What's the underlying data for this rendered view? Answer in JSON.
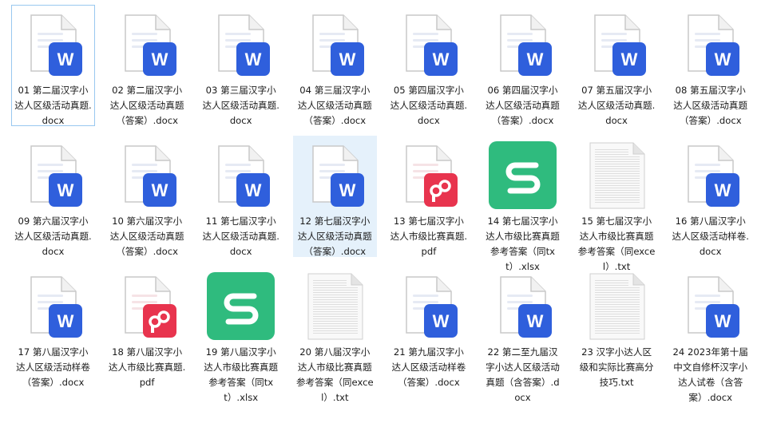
{
  "files": [
    {
      "name": "01 第二届汉字小达人区级活动真题.docx",
      "type": "docx",
      "state": "focused"
    },
    {
      "name": "02 第二届汉字小达人区级活动真题（答案）.docx",
      "type": "docx",
      "state": ""
    },
    {
      "name": "03 第三届汉字小达人区级活动真题.docx",
      "type": "docx",
      "state": ""
    },
    {
      "name": "04 第三届汉字小达人区级活动真题（答案）.docx",
      "type": "docx",
      "state": ""
    },
    {
      "name": "05 第四届汉字小达人区级活动真题.docx",
      "type": "docx",
      "state": ""
    },
    {
      "name": "06 第四届汉字小达人区级活动真题（答案）.docx",
      "type": "docx",
      "state": ""
    },
    {
      "name": "07 第五届汉字小达人区级活动真题.docx",
      "type": "docx",
      "state": ""
    },
    {
      "name": "08 第五届汉字小达人区级活动真题（答案）.docx",
      "type": "docx",
      "state": ""
    },
    {
      "name": "09 第六届汉字小达人区级活动真题.docx",
      "type": "docx",
      "state": ""
    },
    {
      "name": "10 第六届汉字小达人区级活动真题（答案）.docx",
      "type": "docx",
      "state": ""
    },
    {
      "name": "11 第七届汉字小达人区级活动真题.docx",
      "type": "docx",
      "state": ""
    },
    {
      "name": "12 第七届汉字小达人区级活动真题（答案）.docx",
      "type": "docx",
      "state": "selected"
    },
    {
      "name": "13 第七届汉字小达人市级比赛真题.pdf",
      "type": "pdf",
      "state": ""
    },
    {
      "name": "14 第七届汉字小达人市级比赛真题参考答案（同txt）.xlsx",
      "type": "xlsx",
      "state": ""
    },
    {
      "name": "15 第七届汉字小达人市级比赛真题参考答案（同excel）.txt",
      "type": "txt",
      "state": ""
    },
    {
      "name": "16 第八届汉字小达人区级活动样卷.docx",
      "type": "docx",
      "state": ""
    },
    {
      "name": "17 第八届汉字小达人区级活动样卷（答案）.docx",
      "type": "docx",
      "state": ""
    },
    {
      "name": "18 第八届汉字小达人市级比赛真题.pdf",
      "type": "pdf",
      "state": ""
    },
    {
      "name": "19 第八届汉字小达人市级比赛真题参考答案（同txt）.xlsx",
      "type": "xlsx",
      "state": ""
    },
    {
      "name": "20 第八届汉字小达人市级比赛真题参考答案（同excel）.txt",
      "type": "txt",
      "state": ""
    },
    {
      "name": "21 第九届汉字小达人区级活动样卷（答案）.docx",
      "type": "docx",
      "state": ""
    },
    {
      "name": "22 第二至九届汉字小达人区级活动真题（含答案）.docx",
      "type": "docx",
      "state": ""
    },
    {
      "name": "23 汉字小达人区级和实际比赛高分技巧.txt",
      "type": "txt",
      "state": ""
    },
    {
      "name": "24 2023年第十届中文自修杯汉字小达人试卷（含答案）.docx",
      "type": "docx",
      "state": ""
    }
  ],
  "icon_glyphs": {
    "docx": "W",
    "pdf": "P",
    "xlsx": "S",
    "txt": ""
  },
  "icon_names": {
    "docx": "word-doc-icon",
    "pdf": "pdf-icon",
    "xlsx": "spreadsheet-icon",
    "txt": "text-file-icon"
  },
  "colors": {
    "word_blue": "#2f5fdc",
    "pdf_red": "#e8344e",
    "sheet_green": "#2fbb7e",
    "selection": "#e5f1fb",
    "focus_border": "#99c8f0"
  }
}
